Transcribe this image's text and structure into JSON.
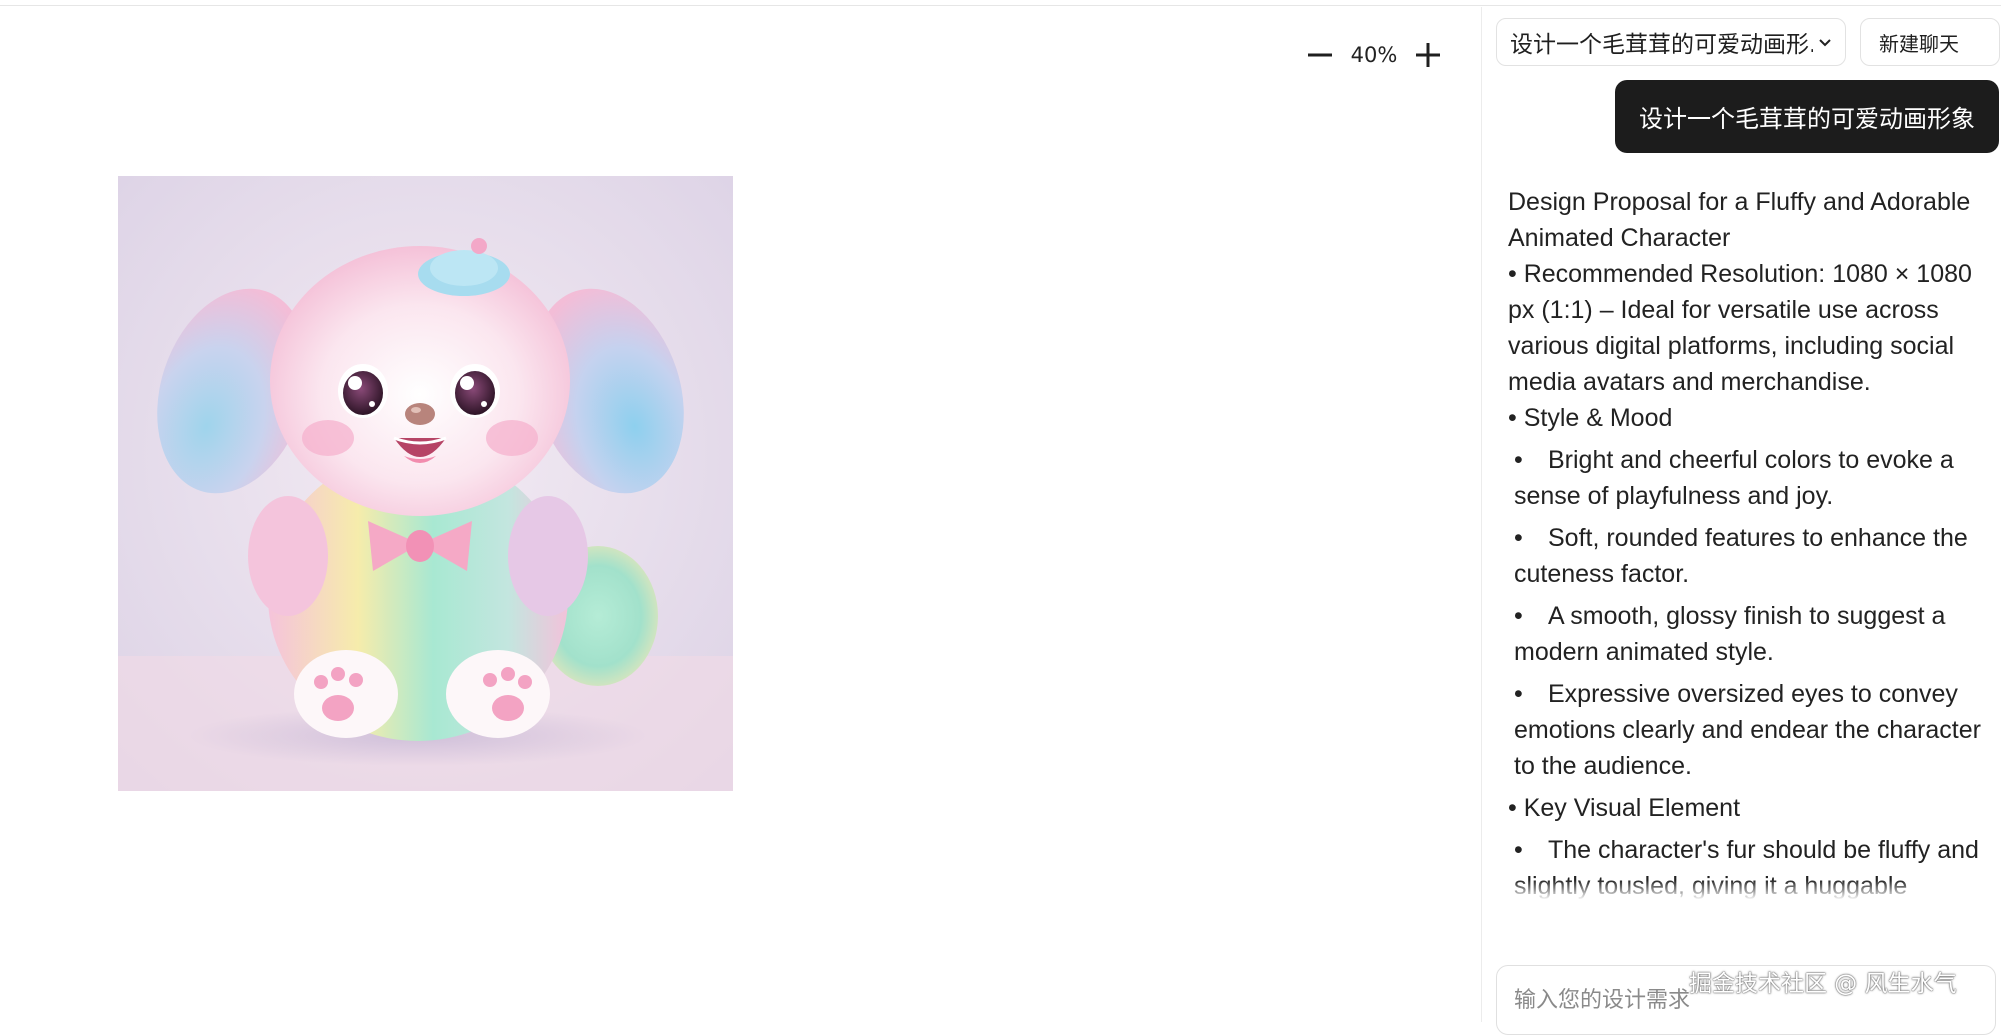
{
  "toolbar": {
    "zoom_out_icon": "minus-icon",
    "zoom_level": "40%",
    "zoom_in_icon": "plus-icon"
  },
  "canvas": {
    "image_subject": "fluffy pastel puppy character"
  },
  "chat": {
    "session_title": "设计一个毛茸茸的可爱动画形...",
    "new_chat_label": "新建聊天",
    "user_message": "设计一个毛茸茸的可爱动画形象",
    "assistant": {
      "title": "Design Proposal for a Fluffy and Adorable Animated Character",
      "resolution": "• Recommended Resolution: 1080 × 1080 px (1:1) – Ideal for versatile use across various digital platforms, including social media avatars and merchandise.",
      "style_heading": "• Style & Mood",
      "style_items": [
        "Bright and cheerful colors to evoke a sense of playfulness and joy.",
        "Soft, rounded features to enhance the cuteness factor.",
        "A smooth, glossy finish to suggest a modern animated style.",
        "Expressive oversized eyes to convey emotions clearly and endear the character to the audience."
      ],
      "key_heading": "• Key Visual Element",
      "key_items": [
        "The character's fur should be fluffy and slightly tousled, giving it a huggable appearance."
      ]
    },
    "input_placeholder": "输入您的设计需求"
  },
  "watermark": "掘金技术社区 @ 风生水气",
  "colors": {
    "bubble_bg": "#1c1c1c",
    "image_bg": "#e8ddec",
    "fur_pink": "#f6c6dc",
    "fur_blue": "#a8d8ea",
    "fur_mint": "#a8e6cf",
    "fur_yellow": "#f7eba8"
  }
}
